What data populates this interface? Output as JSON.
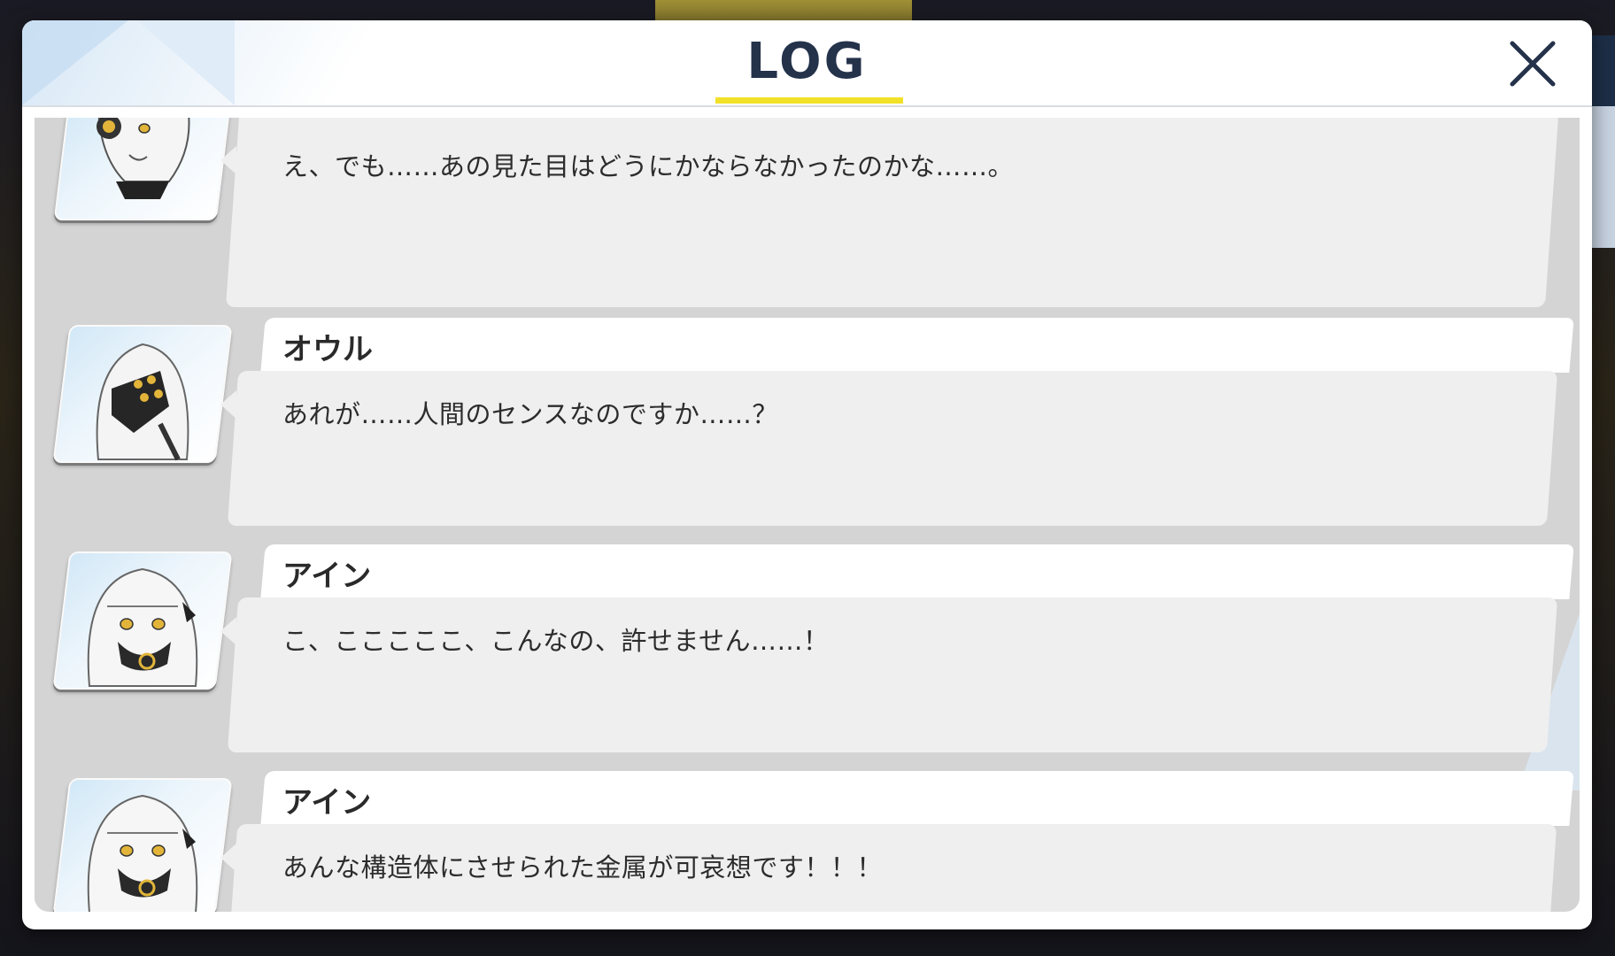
{
  "header": {
    "title": "LOG",
    "close_icon": "close-x-icon"
  },
  "colors": {
    "title": "#24324a",
    "accent_underline": "#f2e12a",
    "log_bg": "#d4d4d4",
    "message_bg": "#efefef",
    "name_bg": "#ffffff"
  },
  "entries": [
    {
      "speaker": "",
      "avatar_icon": "headphone-girl-avatar",
      "text": "え、でも……あの見た目はどうにかならなかったのかな……。"
    },
    {
      "speaker": "オウル",
      "avatar_icon": "masked-owl-avatar",
      "text": "あれが……人間のセンスなのですか……？"
    },
    {
      "speaker": "アイン",
      "avatar_icon": "ein-avatar",
      "text": "こ、こここここ、こんなの、許せません……！"
    },
    {
      "speaker": "アイン",
      "avatar_icon": "ein-avatar",
      "text": "あんな構造体にさせられた金属が可哀想です！！！"
    }
  ]
}
